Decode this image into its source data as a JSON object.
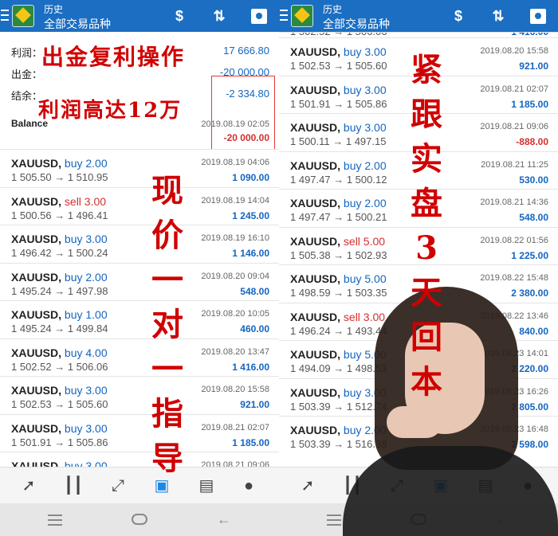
{
  "header": {
    "title_small": "历史",
    "title_main": "全部交易品种"
  },
  "summary": {
    "profit_label": "利润：",
    "profit_value": "17 666.80",
    "withdraw_label": "出金：",
    "withdraw_value": "-20 000.00",
    "balance_label": "结余：",
    "balance_value": "-2 334.80",
    "balance_row_label": "Balance",
    "balance_row_time": "2019.08.19 02:05",
    "balance_row_value": "-20 000.00"
  },
  "left_rows": [
    {
      "symbol": "XAUUSD,",
      "side": "buy 2.00",
      "prices": "1 505.50 → 1 510.95",
      "time": "2019.08.19 04:06",
      "profit": "1 090.00"
    },
    {
      "symbol": "XAUUSD,",
      "side": "sell 3.00",
      "prices": "1 500.56 → 1 496.41",
      "time": "2019.08.19 14:04",
      "profit": "1 245.00"
    },
    {
      "symbol": "XAUUSD,",
      "side": "buy 3.00",
      "prices": "1 496.42 → 1 500.24",
      "time": "2019.08.19 16:10",
      "profit": "1 146.00"
    },
    {
      "symbol": "XAUUSD,",
      "side": "buy 2.00",
      "prices": "1 495.24 → 1 497.98",
      "time": "2019.08.20 09:04",
      "profit": "548.00"
    },
    {
      "symbol": "XAUUSD,",
      "side": "buy 1.00",
      "prices": "1 495.24 → 1 499.84",
      "time": "2019.08.20 10:05",
      "profit": "460.00"
    },
    {
      "symbol": "XAUUSD,",
      "side": "buy 4.00",
      "prices": "1 502.52 → 1 506.06",
      "time": "2019.08.20 13:47",
      "profit": "1 416.00"
    },
    {
      "symbol": "XAUUSD,",
      "side": "buy 3.00",
      "prices": "1 502.53 → 1 505.60",
      "time": "2019.08.20 15:58",
      "profit": "921.00"
    },
    {
      "symbol": "XAUUSD,",
      "side": "buy 3.00",
      "prices": "1 501.91 → 1 505.86",
      "time": "2019.08.21 02:07",
      "profit": "1 185.00"
    },
    {
      "symbol": "XAUUSD,",
      "side": "buy 3.00",
      "prices": "",
      "time": "2019.08.21 09:06",
      "profit": ""
    }
  ],
  "right_rows": [
    {
      "symbol": "",
      "side": "",
      "prices": "1 502.52 → 1 506.06",
      "time": "",
      "profit": "1 416.00"
    },
    {
      "symbol": "XAUUSD,",
      "side": "buy 3.00",
      "prices": "1 502.53 → 1 505.60",
      "time": "2019.08.20 15:58",
      "profit": "921.00"
    },
    {
      "symbol": "XAUUSD,",
      "side": "buy 3.00",
      "prices": "1 501.91 → 1 505.86",
      "time": "2019.08.21 02:07",
      "profit": "1 185.00"
    },
    {
      "symbol": "XAUUSD,",
      "side": "buy 3.00",
      "prices": "1 500.11 → 1 497.15",
      "time": "2019.08.21 09:06",
      "profit": "-888.00"
    },
    {
      "symbol": "XAUUSD,",
      "side": "buy 2.00",
      "prices": "1 497.47 → 1 500.12",
      "time": "2019.08.21 11:25",
      "profit": "530.00"
    },
    {
      "symbol": "XAUUSD,",
      "side": "buy 2.00",
      "prices": "1 497.47 → 1 500.21",
      "time": "2019.08.21 14:36",
      "profit": "548.00"
    },
    {
      "symbol": "XAUUSD,",
      "side": "sell 5.00",
      "prices": "1 505.38 → 1 502.93",
      "time": "2019.08.22 01:56",
      "profit": "1 225.00"
    },
    {
      "symbol": "XAUUSD,",
      "side": "buy 5.00",
      "prices": "1 498.59 → 1 503.35",
      "time": "2019.08.22 15:48",
      "profit": "2 380.00"
    },
    {
      "symbol": "XAUUSD,",
      "side": "sell 3.00",
      "prices": "1 496.24 → 1 493.44",
      "time": "2019.08.22 13:46",
      "profit": "840.00"
    },
    {
      "symbol": "XAUUSD,",
      "side": "buy 5.00",
      "prices": "1 494.09 → 1 498.53",
      "time": "2019.08.23 14:01",
      "profit": "2 220.00"
    },
    {
      "symbol": "XAUUSD,",
      "side": "buy 3.00",
      "prices": "1 503.39 → 1 512.74",
      "time": "2019.08.23 16:26",
      "profit": "2 805.00"
    },
    {
      "symbol": "XAUUSD,",
      "side": "buy 2.00",
      "prices": "1 503.39 → 1 516.38",
      "time": "2019.08.23 16:48",
      "profit": "2 598.00"
    }
  ],
  "overlays": {
    "line1": "出金复利操作",
    "line2": "利润高达12万",
    "vertical_left": "现价一对一指导",
    "vertical_right": "紧跟实盘3天回本"
  },
  "icons": {
    "header": [
      "menu-icon",
      "app-logo-icon",
      "currency-exchange-icon",
      "sort-icon",
      "calendar-icon"
    ],
    "bottom_nav": [
      "trade-arrows-icon",
      "candlestick-icon",
      "chart-line-icon",
      "history-inbox-icon",
      "news-icon",
      "chat-icon"
    ]
  },
  "colors": {
    "header": "#1b6ec2",
    "buy": "#1565c0",
    "sell": "#d32f2f",
    "overlay": "#d10000"
  }
}
